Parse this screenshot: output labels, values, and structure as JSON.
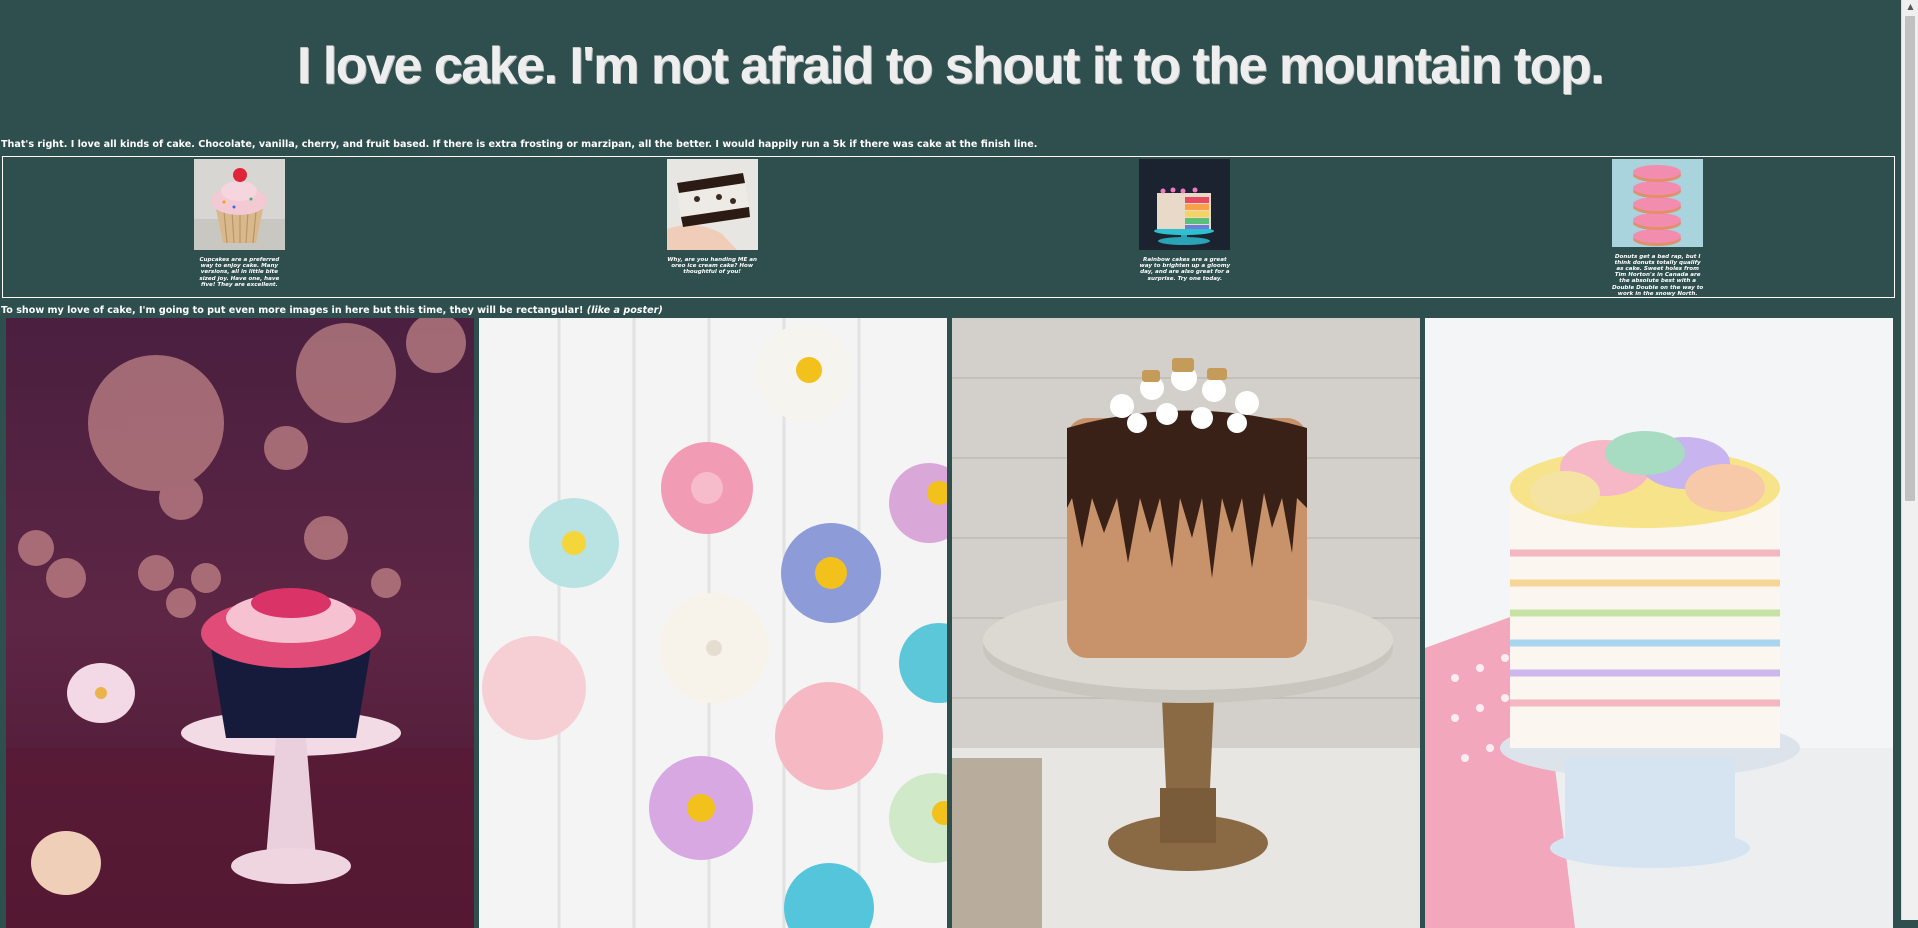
{
  "heading": "I love cake. I'm not afraid to shout it to the mountain top.",
  "intro": "That's right. I love all kinds of cake. Chocolate, vanilla, cherry, and fruit based. If there is extra frosting or marzipan, all the better. I would happily run a 5k if there was cake at the finish line.",
  "gallery": [
    {
      "caption": "Cupcakes are a preferred way to enjoy cake. Many versions, all in little bite sized joy. Have one, have five! They are excellent."
    },
    {
      "caption": "Why, are you handing ME an oreo ice cream cake? How thoughtful of you!"
    },
    {
      "caption": "Rainbow cakes are a great way to brighten up a gloomy day, and are also great for a surprise. Try one today."
    },
    {
      "caption": "Donuts get a bad rap, but I think donuts totally qualify as cake. Sweet holes from Tim Horton's in Canada are the absolute best with a Double Double on the way to work in the snowy North."
    }
  ],
  "subline": {
    "text": "To show my love of cake, I'm going to put even more images in here but this time, they will be rectangular! ",
    "em": "(like a poster)"
  },
  "scrollbar": {
    "up_arrow": "▲"
  }
}
